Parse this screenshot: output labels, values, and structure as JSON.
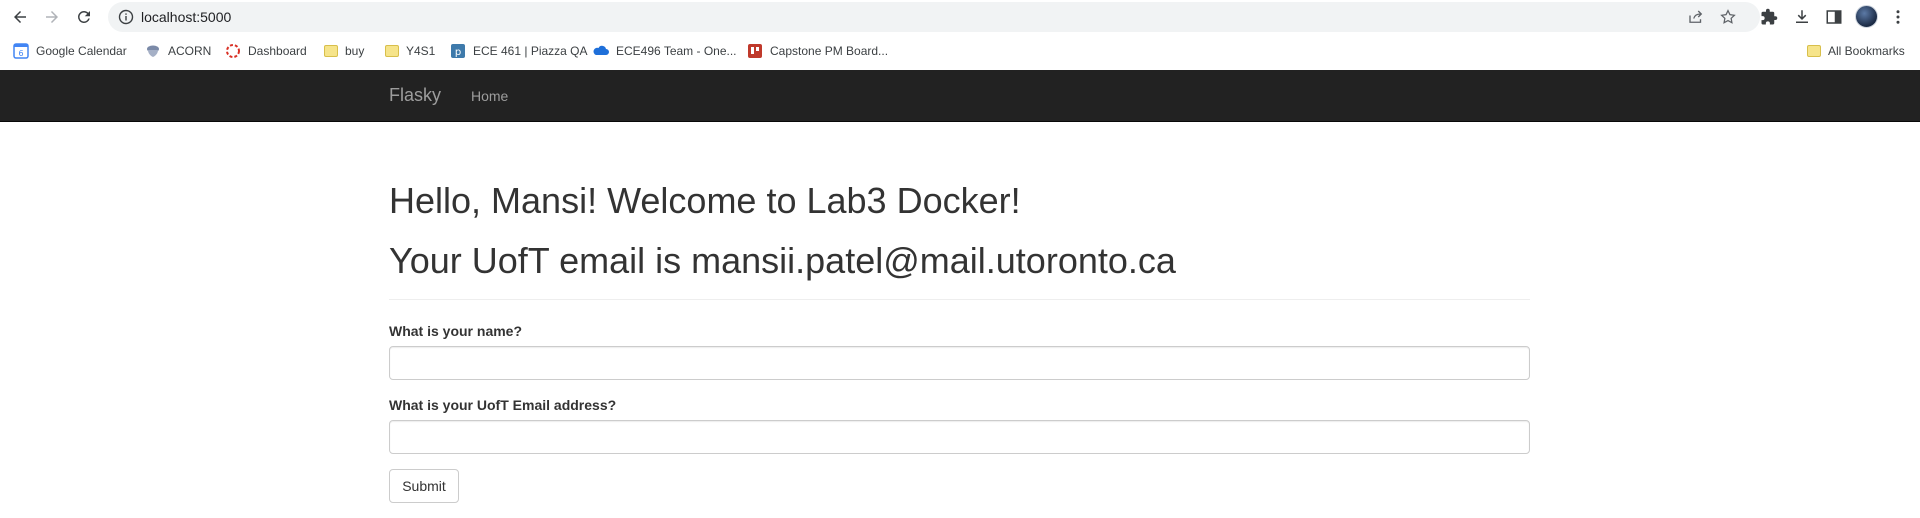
{
  "browser": {
    "url": "localhost:5000",
    "bookmarks": [
      {
        "label": "Google Calendar",
        "icon": "google-calendar-icon"
      },
      {
        "label": "ACORN",
        "icon": "acorn-icon"
      },
      {
        "label": "Dashboard",
        "icon": "dashboard-icon"
      },
      {
        "label": "buy",
        "icon": "folder-icon"
      },
      {
        "label": "Y4S1",
        "icon": "folder-icon"
      },
      {
        "label": "ECE 461 | Piazza QA",
        "icon": "piazza-icon"
      },
      {
        "label": "ECE496 Team - One...",
        "icon": "onedrive-icon"
      },
      {
        "label": "Capstone PM Board...",
        "icon": "trello-icon"
      }
    ],
    "all_bookmarks": "All Bookmarks"
  },
  "navbar": {
    "brand": "Flasky",
    "links": [
      "Home"
    ]
  },
  "main": {
    "greeting": "Hello, Mansi! Welcome to Lab3 Docker!",
    "email_line": "Your UofT email is mansii.patel@mail.utoronto.ca",
    "form": {
      "name_label": "What is your name?",
      "name_value": "",
      "email_label": "What is your UofT Email address?",
      "email_value": "",
      "submit_label": "Submit"
    }
  },
  "colors": {
    "navbar_bg": "#222222",
    "navbar_text": "#9d9d9d",
    "heading_text": "#333333"
  }
}
